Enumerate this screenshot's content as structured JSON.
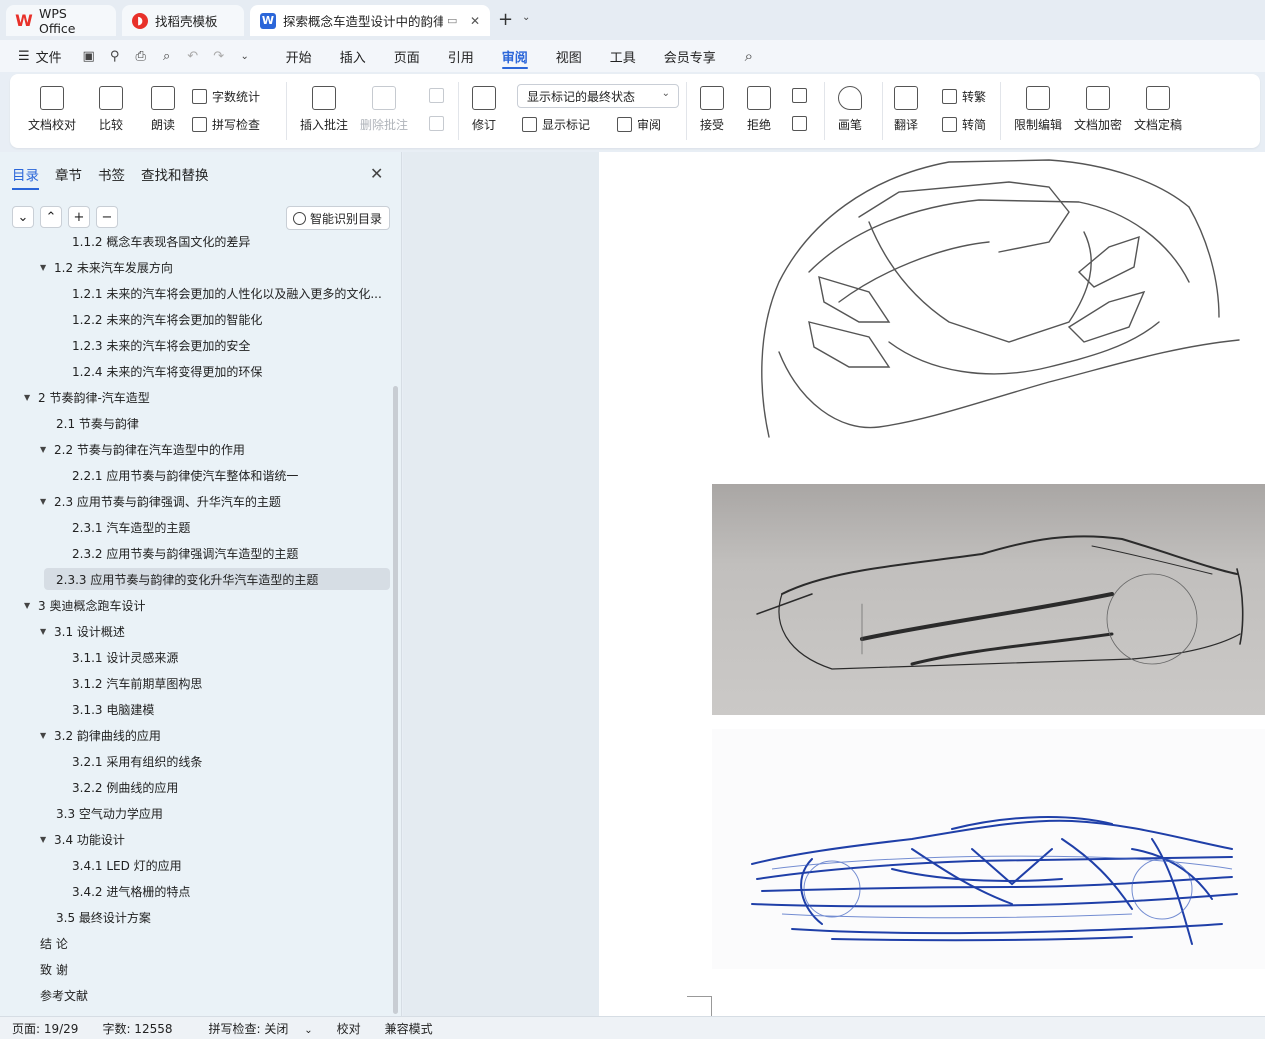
{
  "tabs": [
    {
      "label": "WPS Office",
      "icon": "wps-logo-icon"
    },
    {
      "label": "找稻壳模板",
      "icon": "daoke-logo-icon"
    },
    {
      "label": "探索概念车造型设计中的韵律",
      "icon": "writer-doc-icon"
    }
  ],
  "menu": {
    "file": "文件",
    "items": [
      "开始",
      "插入",
      "页面",
      "引用",
      "审阅",
      "视图",
      "工具",
      "会员专享"
    ],
    "active": "审阅"
  },
  "ribbon": {
    "proofread": "文档校对",
    "compare": "比较",
    "read_aloud": "朗读",
    "word_count": "字数统计",
    "spell_check": "拼写检查",
    "insert_comment": "插入批注",
    "delete_comment": "删除批注",
    "track_changes": "修订",
    "markup_state": "显示标记的最终状态",
    "show_markup": "显示标记",
    "review": "审阅",
    "accept": "接受",
    "reject": "拒绝",
    "ink": "画笔",
    "translate": "翻译",
    "to_traditional": "转繁",
    "to_simplified": "转简",
    "restrict_edit": "限制编辑",
    "encrypt": "文档加密",
    "finalize": "文档定稿"
  },
  "nav": {
    "tabs": [
      "目录",
      "章节",
      "书签",
      "查找和替换"
    ],
    "active_tab": "目录",
    "smart_toc": "智能识别目录",
    "toc": [
      {
        "text": "1.1.2 概念车表现各国文化的差异",
        "level": 3,
        "caret": false
      },
      {
        "text": "1.2  未来汽车发展方向",
        "level": 2,
        "caret": true
      },
      {
        "text": "1.2.1 未来的汽车将会更加的人性化以及融入更多的文化...",
        "level": 3,
        "caret": false
      },
      {
        "text": "1.2.2 未来的汽车将会更加的智能化",
        "level": 3,
        "caret": false
      },
      {
        "text": "1.2.3 未来的汽车将会更加的安全",
        "level": 3,
        "caret": false
      },
      {
        "text": "1.2.4 未来的汽车将变得更加的环保",
        "level": 3,
        "caret": false
      },
      {
        "text": "2 节奏韵律-汽车造型",
        "level": 1,
        "caret": true
      },
      {
        "text": "2.1 节奏与韵律",
        "level": 2,
        "caret": false
      },
      {
        "text": "2.2 节奏与韵律在汽车造型中的作用",
        "level": 2,
        "caret": true
      },
      {
        "text": "2.2.1  应用节奏与韵律使汽车整体和谐统一",
        "level": 3,
        "caret": false
      },
      {
        "text": "2.3  应用节奏与韵律强调、升华汽车的主题",
        "level": 2,
        "caret": true
      },
      {
        "text": "2.3.1  汽车造型的主题",
        "level": 3,
        "caret": false
      },
      {
        "text": "2.3.2  应用节奏与韵律强调汽车造型的主题",
        "level": 3,
        "caret": false
      },
      {
        "text": "2.3.3 应用节奏与韵律的变化升华汽车造型的主题",
        "level": 3,
        "caret": false,
        "selected": true
      },
      {
        "text": "3  奥迪概念跑车设计",
        "level": 1,
        "caret": true
      },
      {
        "text": "3.1 设计概述",
        "level": 2,
        "caret": true
      },
      {
        "text": "3.1.1 设计灵感来源",
        "level": 3,
        "caret": false
      },
      {
        "text": "3.1.2 汽车前期草图构思",
        "level": 3,
        "caret": false
      },
      {
        "text": "3.1.3 电脑建模",
        "level": 3,
        "caret": false
      },
      {
        "text": "3.2 韵律曲线的应用",
        "level": 2,
        "caret": true
      },
      {
        "text": "3.2.1 采用有组织的线条",
        "level": 3,
        "caret": false
      },
      {
        "text": "3.2.2 例曲线的应用",
        "level": 3,
        "caret": false
      },
      {
        "text": "3.3 空气动力学应用",
        "level": 2,
        "caret": false
      },
      {
        "text": "3.4 功能设计",
        "level": 2,
        "caret": true
      },
      {
        "text": "3.4.1 LED 灯的应用",
        "level": 3,
        "caret": false
      },
      {
        "text": "3.4.2 进气格栅的特点",
        "level": 3,
        "caret": false
      },
      {
        "text": "3.5  最终设计方案",
        "level": 2,
        "caret": false
      },
      {
        "text": "结  论",
        "level": 1,
        "caret": false
      },
      {
        "text": "致  谢",
        "level": 1,
        "caret": false
      },
      {
        "text": "参考文献",
        "level": 1,
        "caret": false
      }
    ]
  },
  "status": {
    "page": "页面: 19/29",
    "word_count": "字数: 12558",
    "spell": "拼写检查: 关闭",
    "proof": "校对",
    "compat": "兼容模式"
  },
  "colors": {
    "accent": "#2b66d9",
    "sketch_blue": "#1f3fa8"
  }
}
